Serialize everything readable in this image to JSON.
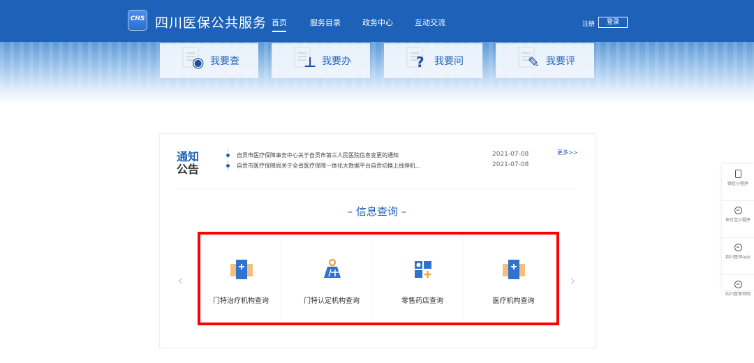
{
  "header": {
    "logo_text": "CHS",
    "title": "四川医保公共服务",
    "nav": [
      "首页",
      "服务目录",
      "政务中心",
      "互动交流"
    ],
    "register": "注册",
    "login": "登录"
  },
  "quick_cards": [
    {
      "label": "我要查",
      "icon": "eye-icon"
    },
    {
      "label": "我要办",
      "icon": "stamp-icon"
    },
    {
      "label": "我要问",
      "icon": "question-icon"
    },
    {
      "label": "我要评",
      "icon": "pen-icon"
    }
  ],
  "notice": {
    "title_1": "通知",
    "title_2": "公告",
    "more": "更多>>",
    "items": [
      {
        "text": "自贡市医疗保障事务中心关于自贡市第三人民医院信息变更的通知",
        "date": "2021-07-08"
      },
      {
        "text": "自贡市医疗保障局关于全省医疗保障一体化大数据平台自贡切换上线停机...",
        "date": "2021-07-08"
      }
    ]
  },
  "info_query": {
    "title": "– 信息查询 –",
    "items": [
      {
        "label": "门特治疗机构查询",
        "icon": "medical-folder-icon"
      },
      {
        "label": "门特认定机构查询",
        "icon": "map-pin-icon"
      },
      {
        "label": "零售药店查询",
        "icon": "grid-plus-icon"
      },
      {
        "label": "医疗机构查询",
        "icon": "medical-folder-icon"
      }
    ],
    "prev": "‹",
    "next": "›"
  },
  "sidebar": [
    {
      "label": "微信小程序",
      "icon": "phone-icon"
    },
    {
      "label": "支付宝小程序",
      "icon": "link-icon"
    },
    {
      "label": "四川医保app",
      "icon": "link-icon"
    },
    {
      "label": "四川医保官网",
      "icon": "link-icon"
    }
  ],
  "colors": {
    "brand": "#1d62b8",
    "highlight": "#ff0000",
    "accent": "#f0a84a"
  }
}
